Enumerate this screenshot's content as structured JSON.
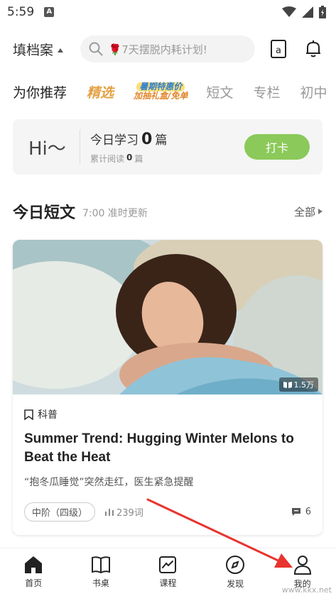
{
  "status": {
    "time": "5:59",
    "notification_badge": "A"
  },
  "header": {
    "category": "填档案",
    "search_placeholder": "🌹7天摆脱内耗计划!"
  },
  "tabs": [
    {
      "label": "为你推荐",
      "active": true
    },
    {
      "label": "精选"
    },
    {
      "label": "暑期特惠价",
      "sub": "加抽礼盒/免单",
      "promo": true
    },
    {
      "label": "短文"
    },
    {
      "label": "专栏"
    },
    {
      "label": "初中"
    }
  ],
  "greeting": {
    "hi": "Hi～",
    "today_label": "今日学习",
    "today_count": "0",
    "today_unit": "篇",
    "total_label": "累计阅读",
    "total_count": "0",
    "total_unit": "篇",
    "checkin_label": "打卡"
  },
  "section": {
    "title": "今日短文",
    "subtitle": "7:00 准时更新",
    "all_label": "全部"
  },
  "article": {
    "views": "1.5万",
    "category": "科普",
    "title": "Summer Trend: Hugging Winter Melons to Beat the Heat",
    "summary": "“抱冬瓜睡觉”突然走红，医生紧急提醒",
    "level": "中阶（四级）",
    "words": "239词",
    "comments": "6"
  },
  "nav": [
    {
      "label": "首页",
      "icon": "home-icon"
    },
    {
      "label": "书桌",
      "icon": "book-icon"
    },
    {
      "label": "课程",
      "icon": "chart-icon"
    },
    {
      "label": "发现",
      "icon": "compass-icon"
    },
    {
      "label": "我的",
      "icon": "person-icon"
    }
  ],
  "colors": {
    "accent": "#5bbf55",
    "checkin": "#8bc95a",
    "featured": "#e3a144",
    "annotation_arrow": "#e8342e"
  },
  "watermark": "www.kkx.net"
}
